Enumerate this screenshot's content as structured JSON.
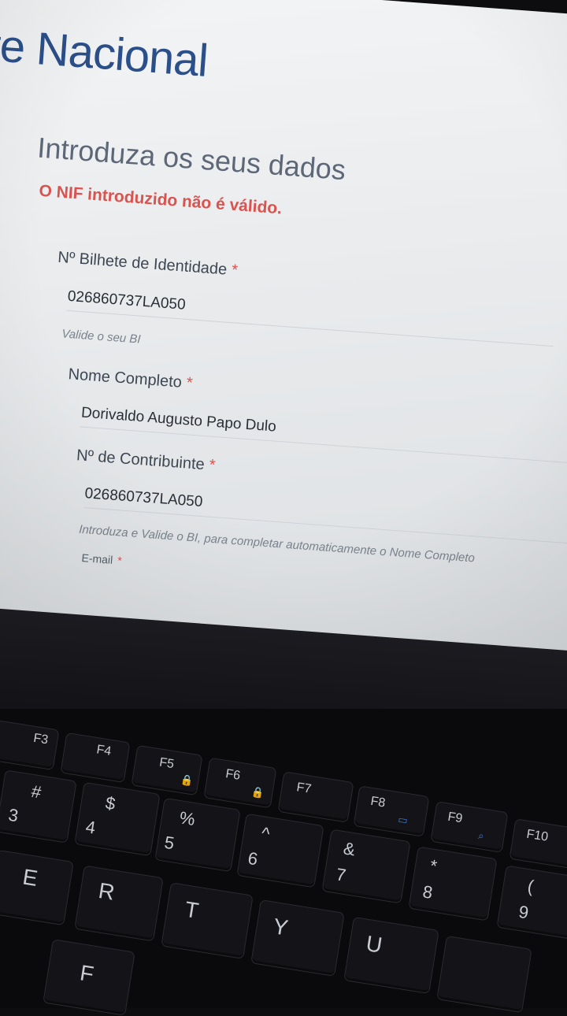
{
  "site": {
    "title_fragment": "te Nacional"
  },
  "form": {
    "section_title": "Introduza os seus dados",
    "error_message": "O NIF introduzido não é válido.",
    "required_marker": "*",
    "fields": [
      {
        "label": "Nº Bilhete de Identidade",
        "value": "026860737LA050",
        "help": "Valide o seu BI"
      },
      {
        "label": "Nome Completo",
        "value": "Dorivaldo  Augusto Papo Dulo"
      },
      {
        "label": "Nº de Contribuinte",
        "value": "026860737LA050",
        "help": "Introduza e Valide o BI, para completar automaticamente o Nome Completo"
      }
    ],
    "partial_next_label": "E-mail"
  },
  "keyboard": {
    "function_keys": [
      "F3",
      "F4",
      "F5",
      "F6",
      "F7",
      "F8",
      "F9",
      "F10"
    ],
    "number_keys": [
      {
        "top": "#",
        "bottom": "3"
      },
      {
        "top": "$",
        "bottom": "4"
      },
      {
        "top": "%",
        "bottom": "5"
      },
      {
        "top": "^",
        "bottom": "6"
      },
      {
        "top": "&",
        "bottom": "7"
      },
      {
        "top": "*",
        "bottom": "8"
      },
      {
        "top": "(",
        "bottom": "9"
      }
    ],
    "letter_keys": [
      "E",
      "R",
      "T",
      "Y",
      "U"
    ],
    "bottom_row_partial": [
      "F"
    ]
  }
}
